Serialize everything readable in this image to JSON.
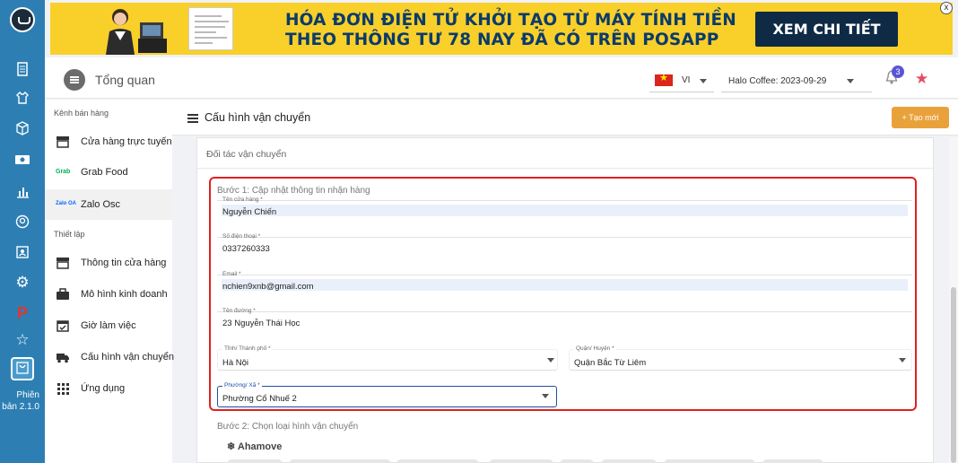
{
  "banner": {
    "headline_line1": "HÓA ĐƠN ĐIỆN TỬ KHỞI TẠO TỪ MÁY TÍNH TIỀN",
    "headline_line2": "THEO THÔNG TƯ 78 NAY ĐÃ CÓ TRÊN POSAPP",
    "cta_label": "XEM CHI TIẾT",
    "close_label": "x"
  },
  "rail": {
    "version_line1": "Phiên",
    "version_line2": "bản 2.1.0",
    "brand_letter": "P"
  },
  "header": {
    "page_title": "Tổng quan",
    "language": "VI",
    "store_selector": "Halo Coffee: 2023-09-29",
    "notification_count": "3"
  },
  "sidebar": {
    "sales_channels_heading": "Kênh bán hàng",
    "sales_channels": [
      {
        "label": "Cửa hàng trực tuyến",
        "icon": "store-icon"
      },
      {
        "label": "Grab Food",
        "icon": "grab-logo-icon",
        "icon_text": "Grab"
      },
      {
        "label": "Zalo Osc",
        "icon": "zalo-logo-icon",
        "icon_text": "Zalo OA"
      }
    ],
    "settings_heading": "Thiết lập",
    "settings": [
      {
        "label": "Thông tin cửa hàng",
        "icon": "store-icon"
      },
      {
        "label": "Mô hình kinh doanh",
        "icon": "briefcase-icon"
      },
      {
        "label": "Giờ làm việc",
        "icon": "calendar-check-icon"
      },
      {
        "label": "Cấu hình vận chuyển",
        "icon": "truck-icon"
      },
      {
        "label": "Ứng dụng",
        "icon": "apps-grid-icon"
      }
    ]
  },
  "main": {
    "section_title": "Cấu hình vận chuyển",
    "create_button": "+ Tạo mới",
    "card_title": "Đối tác vận chuyển",
    "step1_title": "Bước 1: Cập nhật thông tin nhận hàng",
    "fields": {
      "store_name": {
        "label": "Tên cửa hàng *",
        "value": "Nguyễn Chiến"
      },
      "phone": {
        "label": "Số điện thoại *",
        "value": "0337260333"
      },
      "email": {
        "label": "Email *",
        "value": "nchien9xnb@gmail.com"
      },
      "street": {
        "label": "Tên đường *",
        "value": "23 Nguyễn Thái Học"
      },
      "city": {
        "label": "Tỉnh/ Thành phố *",
        "value": "Hà Nội"
      },
      "district": {
        "label": "Quận/ Huyện *",
        "value": "Quận Bắc Từ Liêm"
      },
      "ward": {
        "label": "Phường/ Xã *",
        "value": "Phường Cổ Nhuế 2"
      }
    },
    "step2_title": "Bước 2: Chọn loại hình vận chuyển",
    "carrier_name": "Ahamove"
  },
  "colors": {
    "rail": "#2d7fb3",
    "banner": "#f9cf2a",
    "accent_button": "#e9a23b",
    "highlight_border": "#e02020",
    "focus": "#1f4ea6"
  }
}
